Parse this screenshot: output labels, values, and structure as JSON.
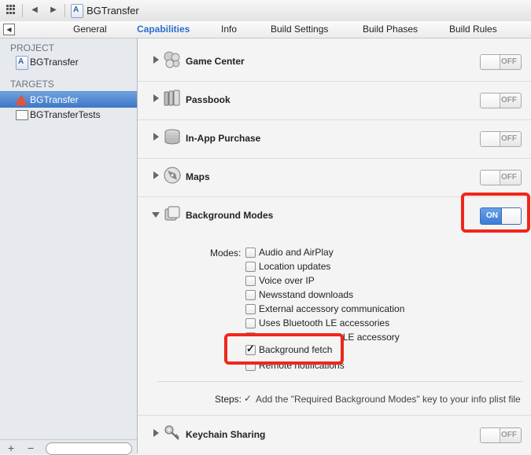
{
  "jumpbar": {
    "breadcrumb": "BGTransfer"
  },
  "tabs": [
    {
      "label": "General",
      "active": false
    },
    {
      "label": "Capabilities",
      "active": true
    },
    {
      "label": "Info",
      "active": false
    },
    {
      "label": "Build Settings",
      "active": false
    },
    {
      "label": "Build Phases",
      "active": false
    },
    {
      "label": "Build Rules",
      "active": false
    }
  ],
  "sidebar": {
    "project_header": "PROJECT",
    "project_item": "BGTransfer",
    "targets_header": "TARGETS",
    "targets": [
      {
        "label": "BGTransfer",
        "selected": true
      },
      {
        "label": "BGTransferTests",
        "selected": false
      }
    ],
    "add": "+",
    "remove": "−"
  },
  "capabilities": [
    {
      "title": "Game Center",
      "icon": "game-center-icon",
      "state": "OFF"
    },
    {
      "title": "Passbook",
      "icon": "passbook-icon",
      "state": "OFF"
    },
    {
      "title": "In-App Purchase",
      "icon": "in-app-purchase-icon",
      "state": "OFF"
    },
    {
      "title": "Maps",
      "icon": "maps-icon",
      "state": "OFF"
    },
    {
      "title": "Background Modes",
      "icon": "background-modes-icon",
      "state": "ON"
    }
  ],
  "modes": {
    "label": "Modes:",
    "items": [
      {
        "label": "Audio and AirPlay",
        "checked": false
      },
      {
        "label": "Location updates",
        "checked": false
      },
      {
        "label": "Voice over IP",
        "checked": false
      },
      {
        "label": "Newsstand downloads",
        "checked": false
      },
      {
        "label": "External accessory communication",
        "checked": false
      },
      {
        "label": "Uses Bluetooth LE accessories",
        "checked": false
      },
      {
        "label": "Acts as a Bluetooth LE accessory",
        "checked": false
      },
      {
        "label": "Background fetch",
        "checked": true
      },
      {
        "label": "Remote notifications",
        "checked": false
      }
    ]
  },
  "steps": {
    "label": "Steps:",
    "check": "✓",
    "text": "Add the \"Required Background Modes\" key to your info plist file"
  },
  "keychain": {
    "title": "Keychain Sharing",
    "icon": "keychain-icon",
    "state": "OFF"
  }
}
